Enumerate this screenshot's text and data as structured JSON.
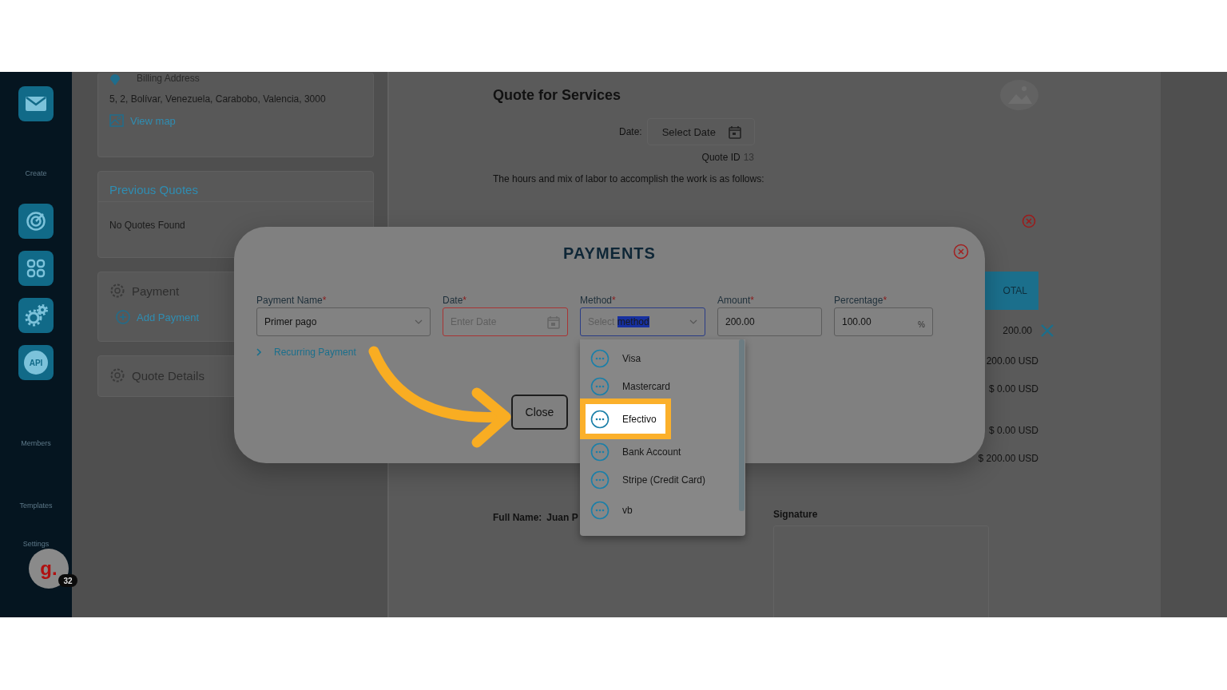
{
  "sidebar": {
    "items": [
      {
        "kind": "button"
      },
      {
        "kind": "label",
        "text": "Create"
      },
      {
        "kind": "button"
      },
      {
        "kind": "button"
      },
      {
        "kind": "button"
      },
      {
        "kind": "api-button",
        "text": "API"
      },
      {
        "kind": "label",
        "text": "Members"
      },
      {
        "kind": "label",
        "text": "Templates"
      },
      {
        "kind": "label",
        "text": "Settings"
      }
    ],
    "avatar": {
      "letter": "g.",
      "badge": "32"
    }
  },
  "cards": {
    "billing": {
      "title": "Billing Address",
      "address": "5, 2, Bolívar, Venezuela, Carabobo, Valencia, 3000",
      "link": "View map"
    },
    "previous_quotes": {
      "title": "Previous Quotes",
      "message": "No Quotes Found"
    },
    "payment": {
      "title": "Payment",
      "action": "Add Payment"
    },
    "quote_details": {
      "title": "Quote Details"
    }
  },
  "document": {
    "title": "Quote for Services",
    "date_label": "Date:",
    "date_placeholder": "Select Date",
    "quote_id_label": "Quote ID",
    "quote_id": "13",
    "intro": "The hours and mix of labor to accomplish the work is as follows:",
    "total_button": "OTAL",
    "totals": [
      {
        "text": "200.00",
        "removable": true
      },
      {
        "text": "200.00 USD",
        "removable": false
      },
      {
        "text": "$ 0.00 USD",
        "removable": false
      },
      {
        "text": "$ 0.00 USD",
        "removable": false
      },
      {
        "text": "$ 200.00 USD",
        "removable": false
      }
    ],
    "full_name_label": "Full Name:",
    "full_name": "Juan P",
    "signature_label": "Signature"
  },
  "modal": {
    "title": "PAYMENTS",
    "fields": [
      {
        "kind": "select",
        "label": "Payment Name",
        "required_mark": "*",
        "value": "Primer pago",
        "error": false,
        "focused": false
      },
      {
        "kind": "date",
        "label": "Date",
        "required_mark": "*",
        "placeholder": "Enter Date",
        "error": true,
        "focused": false
      },
      {
        "kind": "select",
        "label": "Method",
        "required_mark": "*",
        "placeholder": "Select ",
        "selection": "method",
        "error": false,
        "focused": true
      },
      {
        "kind": "text",
        "label": "Amount",
        "required_mark": "*",
        "value": "200.00",
        "error": false,
        "focused": false
      },
      {
        "kind": "percent",
        "label": "Percentage",
        "required_mark": "*",
        "value": "100.00",
        "suffix": "%",
        "error": false,
        "focused": false
      }
    ],
    "recurring_link": "Recurring Payment",
    "close_button": "Close",
    "options": [
      {
        "label": "Visa",
        "selected": false
      },
      {
        "label": "Mastercard",
        "selected": false
      },
      {
        "label": "Efectivo",
        "selected": true
      },
      {
        "label": "Bank Account",
        "selected": false
      },
      {
        "label": "Stripe (Credit Card)",
        "selected": false
      },
      {
        "label": "vb",
        "selected": false
      }
    ]
  }
}
